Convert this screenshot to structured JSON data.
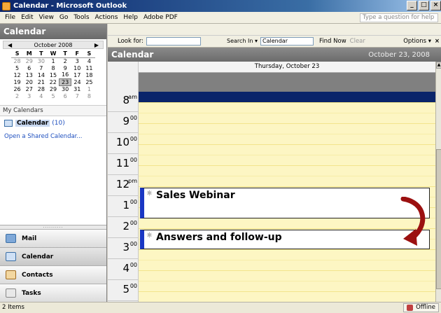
{
  "window": {
    "title": "Calendar - Microsoft Outlook"
  },
  "menu": {
    "items": [
      "File",
      "Edit",
      "View",
      "Go",
      "Tools",
      "Actions",
      "Help",
      "Adobe PDF"
    ],
    "help_placeholder": "Type a question for help"
  },
  "left_pane": {
    "title": "Calendar",
    "mini_calendar": {
      "month_label": "October 2008",
      "weekdays": [
        "S",
        "M",
        "T",
        "W",
        "T",
        "F",
        "S"
      ],
      "weeks": [
        [
          {
            "d": "28",
            "dim": true
          },
          {
            "d": "29",
            "dim": true
          },
          {
            "d": "30",
            "dim": true
          },
          {
            "d": "1"
          },
          {
            "d": "2"
          },
          {
            "d": "3"
          },
          {
            "d": "4"
          }
        ],
        [
          {
            "d": "5"
          },
          {
            "d": "6"
          },
          {
            "d": "7"
          },
          {
            "d": "8"
          },
          {
            "d": "9"
          },
          {
            "d": "10"
          },
          {
            "d": "11"
          }
        ],
        [
          {
            "d": "12"
          },
          {
            "d": "13"
          },
          {
            "d": "14"
          },
          {
            "d": "15"
          },
          {
            "d": "16"
          },
          {
            "d": "17"
          },
          {
            "d": "18"
          }
        ],
        [
          {
            "d": "19"
          },
          {
            "d": "20"
          },
          {
            "d": "21"
          },
          {
            "d": "22"
          },
          {
            "d": "23",
            "today": true
          },
          {
            "d": "24"
          },
          {
            "d": "25"
          }
        ],
        [
          {
            "d": "26"
          },
          {
            "d": "27"
          },
          {
            "d": "28"
          },
          {
            "d": "29"
          },
          {
            "d": "30"
          },
          {
            "d": "31"
          },
          {
            "d": "1",
            "dim": true
          }
        ],
        [
          {
            "d": "2",
            "dim": true
          },
          {
            "d": "3",
            "dim": true
          },
          {
            "d": "4",
            "dim": true
          },
          {
            "d": "5",
            "dim": true
          },
          {
            "d": "6",
            "dim": true
          },
          {
            "d": "7",
            "dim": true
          },
          {
            "d": "8",
            "dim": true
          }
        ]
      ]
    },
    "my_calendars_label": "My Calendars",
    "calendar_entry": {
      "name": "Calendar",
      "count": "(10)"
    },
    "shared_link": "Open a Shared Calendar...",
    "nav_buttons": [
      {
        "label": "Mail",
        "icon": "mail-icon",
        "active": false
      },
      {
        "label": "Calendar",
        "icon": "calendar-icon",
        "active": true
      },
      {
        "label": "Contacts",
        "icon": "contacts-icon",
        "active": false
      },
      {
        "label": "Tasks",
        "icon": "tasks-icon",
        "active": false
      }
    ]
  },
  "search": {
    "look_for_label": "Look for:",
    "search_in_label": "Search In ▾",
    "search_in_value": "Calendar",
    "find_now": "Find Now",
    "clear": "Clear",
    "options": "Options ▾"
  },
  "calendar": {
    "header_title": "Calendar",
    "header_date": "October 23, 2008",
    "day_label": "Thursday, October 23",
    "hours": [
      {
        "n": "8",
        "s": "am"
      },
      {
        "n": "9",
        "s": "00"
      },
      {
        "n": "10",
        "s": "00"
      },
      {
        "n": "11",
        "s": "00"
      },
      {
        "n": "12",
        "s": "pm"
      },
      {
        "n": "1",
        "s": "00"
      },
      {
        "n": "2",
        "s": "00"
      },
      {
        "n": "3",
        "s": "00"
      },
      {
        "n": "4",
        "s": "00"
      },
      {
        "n": "5",
        "s": "00"
      }
    ],
    "appointments": [
      {
        "title": "Sales Webinar"
      },
      {
        "title": "Answers and follow-up"
      }
    ]
  },
  "status": {
    "items_count": "2 Items",
    "offline": "Offline"
  },
  "colors": {
    "accent_blue": "#1a37c4",
    "workday_yellow": "#fdf6c3",
    "arrow_red": "#9b1010"
  }
}
